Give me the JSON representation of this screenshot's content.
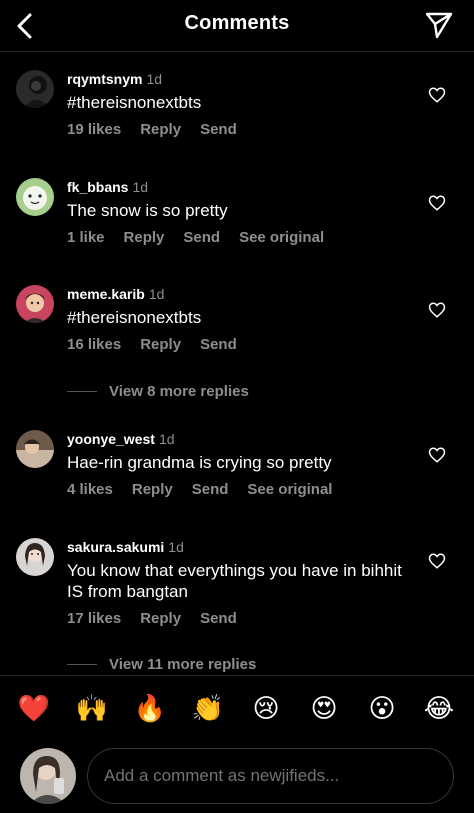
{
  "header": {
    "title": "Comments",
    "back_icon": "chevron-left-icon",
    "share_icon": "paper-plane-icon"
  },
  "comments": [
    {
      "username": "rqymtsnym",
      "time": "1d",
      "text": "#thereisnonextbts",
      "likes": "19 likes",
      "reply": "Reply",
      "send": "Send",
      "see_original": ""
    },
    {
      "username": "fk_bbans",
      "time": "1d",
      "text": "The snow is so pretty",
      "likes": "1 like",
      "reply": "Reply",
      "send": "Send",
      "see_original": "See original"
    },
    {
      "username": "meme.karib",
      "time": "1d",
      "text": "#thereisnonextbts",
      "likes": "16 likes",
      "reply": "Reply",
      "send": "Send",
      "see_original": ""
    },
    {
      "username": "yoonye_west",
      "time": "1d",
      "text": "Hae-rin grandma is crying so pretty",
      "likes": "4 likes",
      "reply": "Reply",
      "send": "Send",
      "see_original": "See original"
    },
    {
      "username": "sakura.sakumi",
      "time": "1d",
      "text": "You know that everythings you have in bihhit IS from bangtan",
      "likes": "17 likes",
      "reply": "Reply",
      "send": "Send",
      "see_original": ""
    }
  ],
  "view_replies": [
    "View 8 more replies",
    "View 11 more replies"
  ],
  "emoji_bar": [
    "❤️",
    "🙌",
    "🔥",
    "👏",
    "😢",
    "😍",
    "😮",
    "😂"
  ],
  "composer": {
    "placeholder": "Add a comment as newjifieds..."
  },
  "colors": {
    "background": "#000000",
    "secondary_text": "#8e8e8e",
    "heart_red": "#ed4956"
  }
}
